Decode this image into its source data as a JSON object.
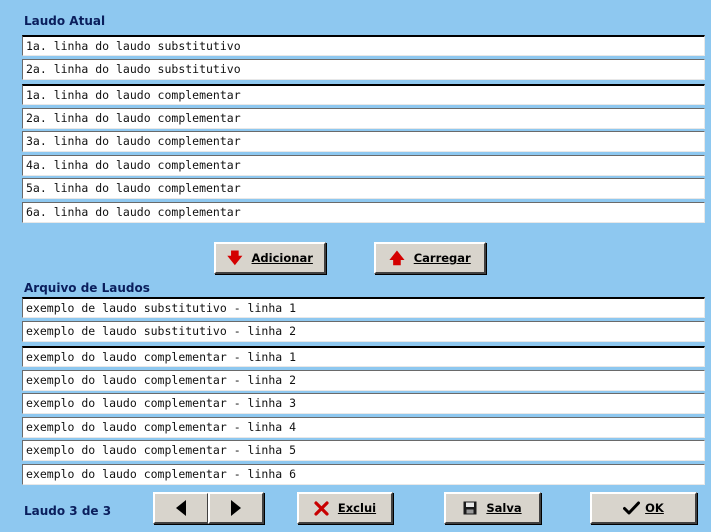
{
  "atual": {
    "title": "Laudo Atual",
    "substitutivo": [
      "1a. linha do laudo substitutivo",
      "2a. linha do laudo substitutivo"
    ],
    "complementar": [
      "1a. linha do laudo complementar",
      "2a. linha do laudo complementar",
      "3a. linha do laudo complementar",
      "4a. linha do laudo complementar",
      "5a. linha do laudo complementar",
      "6a. linha do laudo complementar"
    ]
  },
  "buttons": {
    "adicionar": "Adicionar",
    "carregar": "Carregar",
    "exclui": "Exclui",
    "salva": "Salva",
    "ok": "OK"
  },
  "arquivo": {
    "title": "Arquivo de Laudos",
    "substitutivo": [
      "exemplo de laudo substitutivo - linha 1",
      "exemplo de laudo substitutivo - linha 2"
    ],
    "complementar": [
      "exemplo do laudo complementar - linha 1",
      "exemplo do laudo complementar - linha 2",
      "exemplo do laudo complementar - linha 3",
      "exemplo do laudo complementar - linha 4",
      "exemplo do laudo complementar - linha 5",
      "exemplo do laudo complementar - linha 6"
    ]
  },
  "status": "Laudo 3 de 3",
  "icons": {
    "adicionar": "arrow-down-icon",
    "carregar": "arrow-up-icon",
    "prev": "triangle-left-icon",
    "next": "triangle-right-icon",
    "exclui": "x-icon",
    "salva": "floppy-disk-icon",
    "ok": "checkmark-icon"
  },
  "colors": {
    "background": "#8ec8f0",
    "title": "#0a1e5c",
    "arrow": "#d40000",
    "button": "#d8d4cc"
  }
}
